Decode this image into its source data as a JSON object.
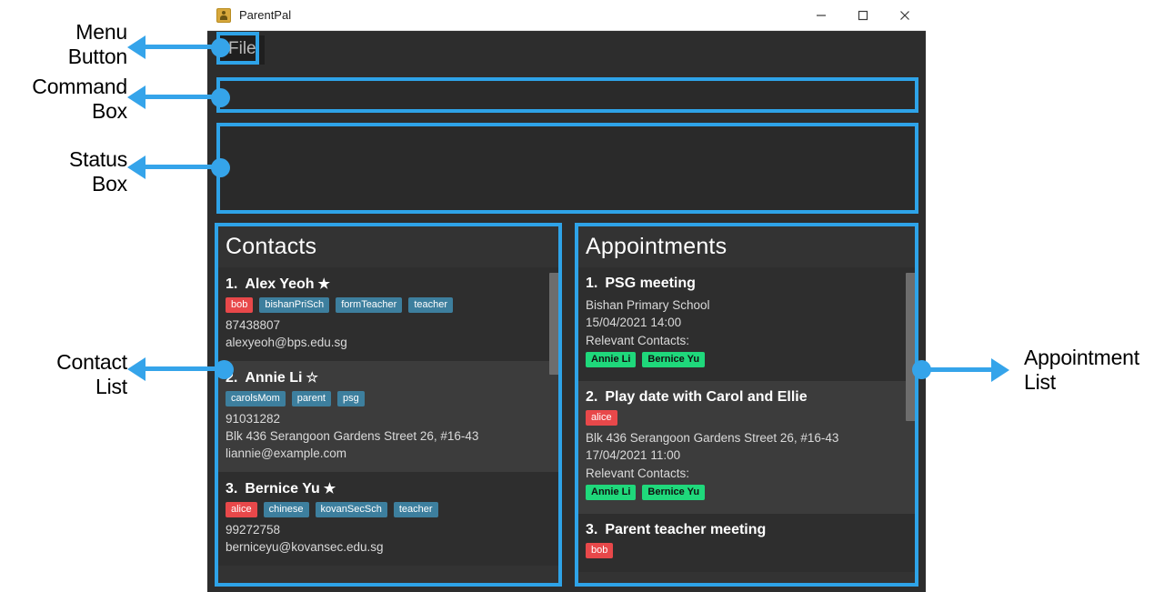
{
  "window": {
    "title": "ParentPal",
    "icon": "person-card-icon",
    "controls": {
      "minimize": "minimize-icon",
      "maximize": "maximize-icon",
      "close": "close-icon"
    }
  },
  "menu": {
    "file_label": "File"
  },
  "command_box": {
    "value": "",
    "placeholder": ""
  },
  "status_box": {
    "value": ""
  },
  "contacts_panel": {
    "title": "Contacts",
    "items": [
      {
        "index": "1.",
        "name": "Alex Yeoh",
        "starred": true,
        "star_glyph": "★",
        "tags": [
          {
            "label": "bob",
            "color": "red"
          },
          {
            "label": "bishanPriSch",
            "color": "blue"
          },
          {
            "label": "formTeacher",
            "color": "blue"
          },
          {
            "label": "teacher",
            "color": "blue"
          }
        ],
        "phone": "87438807",
        "address": "",
        "email": "alexyeoh@bps.edu.sg"
      },
      {
        "index": "2.",
        "name": "Annie Li",
        "starred": false,
        "star_glyph": "☆",
        "tags": [
          {
            "label": "carolsMom",
            "color": "blue"
          },
          {
            "label": "parent",
            "color": "blue"
          },
          {
            "label": "psg",
            "color": "blue"
          }
        ],
        "phone": "91031282",
        "address": "Blk 436 Serangoon Gardens Street 26, #16-43",
        "email": "liannie@example.com"
      },
      {
        "index": "3.",
        "name": "Bernice Yu",
        "starred": true,
        "star_glyph": "★",
        "tags": [
          {
            "label": "alice",
            "color": "red"
          },
          {
            "label": "chinese",
            "color": "blue"
          },
          {
            "label": "kovanSecSch",
            "color": "blue"
          },
          {
            "label": "teacher",
            "color": "blue"
          }
        ],
        "phone": "99272758",
        "address": "",
        "email": "berniceyu@kovansec.edu.sg"
      }
    ]
  },
  "appointments_panel": {
    "title": "Appointments",
    "relevant_contacts_label": "Relevant Contacts:",
    "items": [
      {
        "index": "1.",
        "name": "PSG meeting",
        "tags": [],
        "location": "Bishan Primary School",
        "datetime": "15/04/2021 14:00",
        "contacts": [
          "Annie Li",
          "Bernice Yu"
        ]
      },
      {
        "index": "2.",
        "name": "Play date with Carol and Ellie",
        "tags": [
          {
            "label": "alice",
            "color": "red"
          }
        ],
        "location": "Blk 436 Serangoon Gardens Street 26, #16-43",
        "datetime": "17/04/2021 11:00",
        "contacts": [
          "Annie Li",
          "Bernice Yu"
        ]
      },
      {
        "index": "3.",
        "name": "Parent teacher meeting",
        "tags": [
          {
            "label": "bob",
            "color": "red"
          }
        ],
        "location": "",
        "datetime": "",
        "contacts": []
      }
    ]
  },
  "annotations": [
    {
      "id": "menu-button",
      "text": "Menu\nButton"
    },
    {
      "id": "command-box",
      "text": "Command\nBox"
    },
    {
      "id": "status-box",
      "text": "Status\nBox"
    },
    {
      "id": "contact-list",
      "text": "Contact\nList"
    },
    {
      "id": "appointment-list",
      "text": "Appointment\nList"
    }
  ],
  "colors": {
    "accent": "#2ea3e8",
    "arrow": "#35a4ea",
    "tag_blue": "#3d7f9e",
    "tag_red": "#e8484a",
    "tag_green": "#1fd87b",
    "window_bg": "#2d2d2d",
    "panel_bg": "#333333"
  }
}
